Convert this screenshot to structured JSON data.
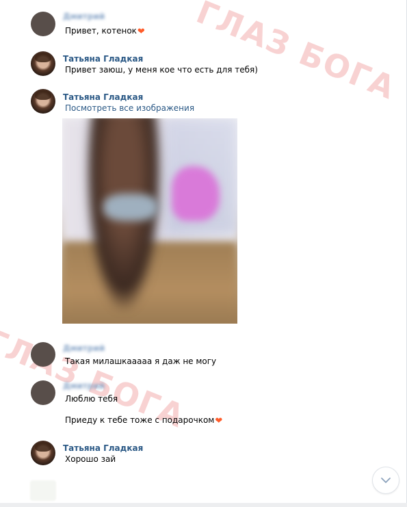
{
  "watermark": {
    "top_text": "ГЛАЗ БОГА",
    "bottom_text": "ГЛАЗ БОГА"
  },
  "messages": [
    {
      "author": "Дмитрий",
      "author_blurred": true,
      "avatar": "gray",
      "text": "Привет, котенок",
      "emoji": "heart"
    },
    {
      "author": "Татьяна Гладкая",
      "author_blurred": false,
      "avatar": "photo",
      "text": "Привет заюш, у меня кое что есть для тебя)"
    },
    {
      "author": "Татьяна Гладкая",
      "author_blurred": false,
      "avatar": "photo",
      "link": "Посмотреть все изображения",
      "attachment": "photo"
    },
    {
      "author": "Дмитрий",
      "author_blurred": true,
      "avatar": "gray",
      "text": "Такая милашкаааaа я даж не могу"
    },
    {
      "author": "Дмитрий",
      "author_blurred": true,
      "avatar": "gray",
      "text": "Люблю тебя",
      "text2": "Приеду к тебе тоже с подарочком",
      "emoji2": "heart"
    },
    {
      "author": "Татьяна Гладкая",
      "author_blurred": false,
      "avatar": "photo",
      "text": "Хорошо зай"
    }
  ],
  "icons": {
    "scroll_down": "chevron-down-icon",
    "heart": "heart-emoji-icon"
  },
  "colors": {
    "author_link": "#2a5885",
    "watermark": "#f6c4c4",
    "heart": "#ff5c2a"
  }
}
